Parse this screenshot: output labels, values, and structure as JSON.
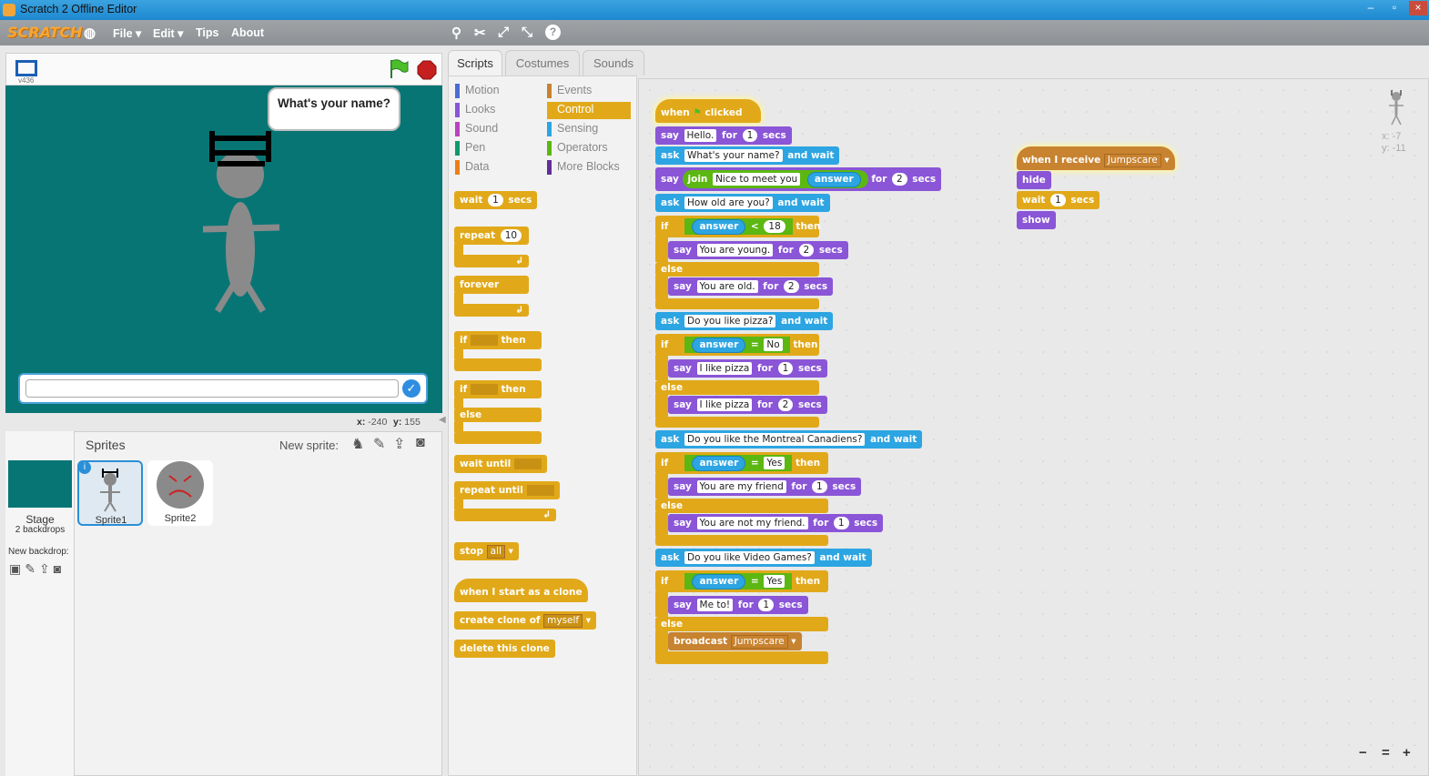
{
  "window": {
    "title": "Scratch 2 Offline Editor"
  },
  "menu": {
    "logo": "SCRATCH",
    "items": [
      "File ▾",
      "Edit ▾",
      "Tips",
      "About"
    ]
  },
  "stage": {
    "version": "v436",
    "bubble_text": "What's your name?",
    "coords": {
      "x_label": "x:",
      "x": "-240",
      "y_label": "y:",
      "y": "155"
    }
  },
  "sprites": {
    "header": "Sprites",
    "new_sprite": "New sprite:",
    "stage_label": "Stage",
    "stage_sub": "2 backdrops",
    "new_backdrop": "New backdrop:",
    "list": [
      "Sprite1",
      "Sprite2"
    ]
  },
  "tabs": [
    "Scripts",
    "Costumes",
    "Sounds"
  ],
  "categories": [
    {
      "name": "Motion",
      "color": "#4a6cd4"
    },
    {
      "name": "Events",
      "color": "#c88330"
    },
    {
      "name": "Looks",
      "color": "#8a55d7"
    },
    {
      "name": "Control",
      "color": "#e1a91a"
    },
    {
      "name": "Sound",
      "color": "#bb42c3"
    },
    {
      "name": "Sensing",
      "color": "#2ca5e2"
    },
    {
      "name": "Pen",
      "color": "#0e9a6c"
    },
    {
      "name": "Operators",
      "color": "#5cb712"
    },
    {
      "name": "Data",
      "color": "#ee7d16"
    },
    {
      "name": "More Blocks",
      "color": "#632d99"
    }
  ],
  "palette": {
    "wait": [
      "wait",
      "1",
      "secs"
    ],
    "repeat": [
      "repeat",
      "10"
    ],
    "forever": "forever",
    "if": [
      "if",
      "then"
    ],
    "else": "else",
    "wait_until": "wait until",
    "repeat_until": "repeat until",
    "stop": [
      "stop",
      "all"
    ],
    "clone_hat": "when I start as a clone",
    "create_clone": [
      "create clone of",
      "myself"
    ],
    "delete_clone": "delete this clone"
  },
  "script": {
    "hat": [
      "when",
      "clicked"
    ],
    "b1": [
      "say",
      "Hello.",
      "for",
      "1",
      "secs"
    ],
    "b2": [
      "ask",
      "What's your name?",
      "and wait"
    ],
    "b3": [
      "say",
      "join",
      "Nice to meet you",
      "answer",
      "for",
      "2",
      "secs"
    ],
    "b4": [
      "ask",
      "How old are you?",
      "and wait"
    ],
    "if1": [
      "if",
      "answer",
      "<",
      "18",
      "then"
    ],
    "b5": [
      "say",
      "You are young.",
      "for",
      "2",
      "secs"
    ],
    "else": "else",
    "b6": [
      "say",
      "You are old.",
      "for",
      "2",
      "secs"
    ],
    "b7": [
      "ask",
      "Do you like pizza?",
      "and wait"
    ],
    "if2": [
      "if",
      "answer",
      "=",
      "No",
      "then"
    ],
    "b8": [
      "say",
      "I like pizza",
      "for",
      "1",
      "secs"
    ],
    "b9": [
      "say",
      "I like pizza",
      "for",
      "2",
      "secs"
    ],
    "b10": [
      "ask",
      "Do you like the Montreal Canadiens?",
      "and wait"
    ],
    "if3": [
      "if",
      "answer",
      "=",
      "Yes",
      "then"
    ],
    "b11": [
      "say",
      "You are my friend",
      "for",
      "1",
      "secs"
    ],
    "b12": [
      "say",
      "You are not my friend.",
      "for",
      "1",
      "secs"
    ],
    "b13": [
      "ask",
      "Do you like Video Games?",
      "and wait"
    ],
    "if4": [
      "if",
      "answer",
      "=",
      "Yes",
      "then"
    ],
    "b14": [
      "say",
      "Me to!",
      "for",
      "1",
      "secs"
    ],
    "b15": [
      "broadcast",
      "Jumpscare"
    ]
  },
  "script2": {
    "hat": [
      "when I receive",
      "Jumpscare"
    ],
    "hide": "hide",
    "wait": [
      "wait",
      "1",
      "secs"
    ],
    "show": "show"
  },
  "sprite_info": {
    "x": "x: -7",
    "y": "y: -11"
  },
  "zoom": [
    "−",
    "=",
    "+"
  ]
}
